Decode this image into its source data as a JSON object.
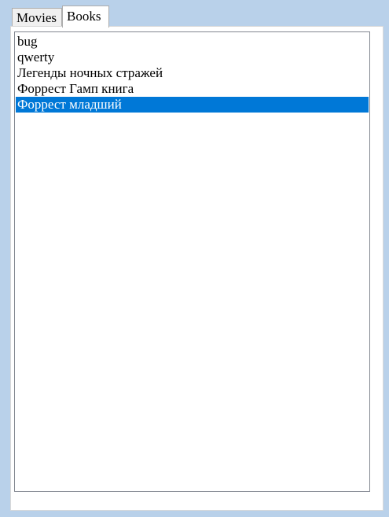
{
  "tabs": [
    {
      "label": "Movies",
      "active": false
    },
    {
      "label": "Books",
      "active": true
    }
  ],
  "books_list": {
    "items": [
      "bug",
      "qwerty",
      "Легенды ночных стражей",
      "Форрест Гамп книга",
      "Форрест младший"
    ],
    "selected_index": 4
  },
  "colors": {
    "window_background": "#b9d1ea",
    "selection_background": "#0078d7",
    "selection_text": "#ffffff",
    "list_border": "#828790"
  }
}
